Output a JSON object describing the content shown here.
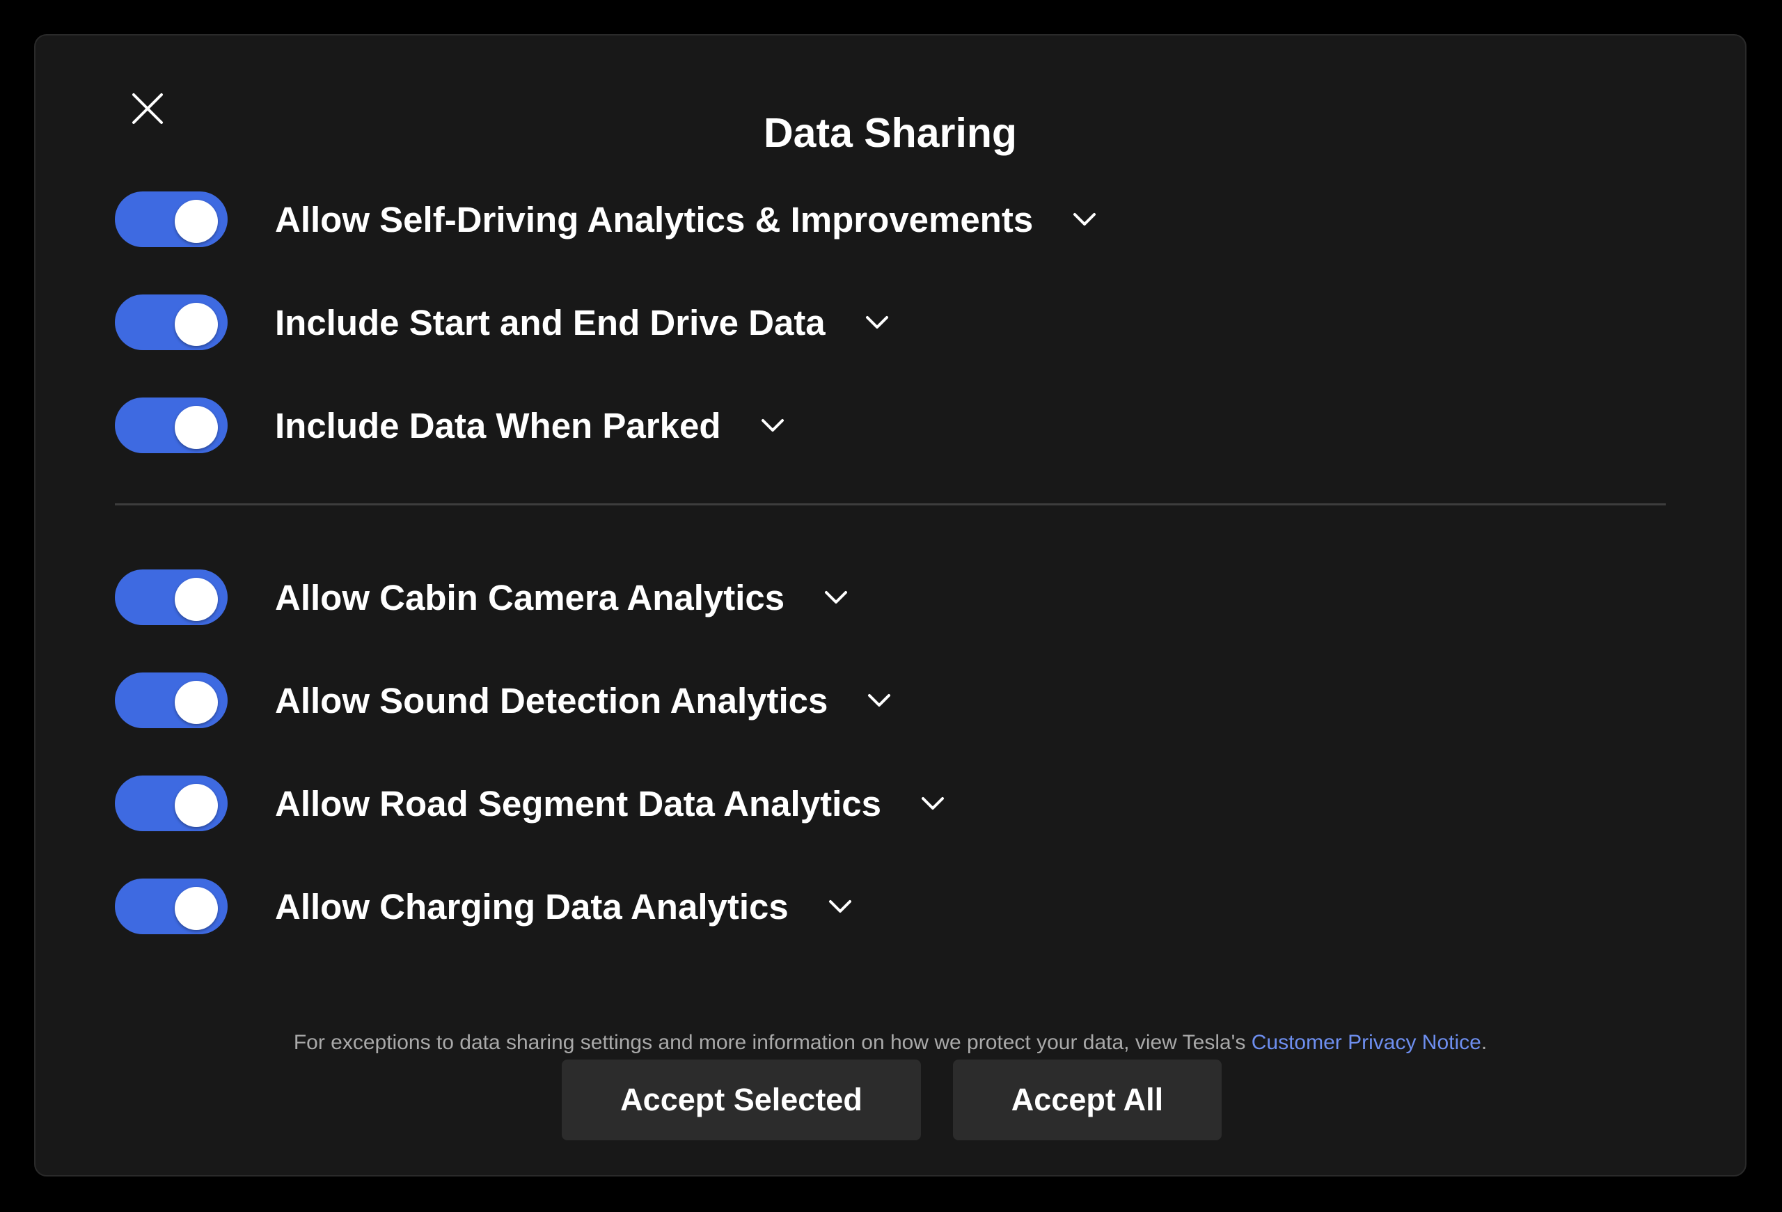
{
  "dialog": {
    "title": "Data Sharing",
    "close_icon": "close-icon"
  },
  "toggles_group1": [
    {
      "label": "Allow Self-Driving Analytics & Improvements",
      "enabled": true
    },
    {
      "label": "Include Start and End Drive Data",
      "enabled": true
    },
    {
      "label": "Include Data When Parked",
      "enabled": true
    }
  ],
  "toggles_group2": [
    {
      "label": "Allow Cabin Camera Analytics",
      "enabled": true
    },
    {
      "label": "Allow Sound Detection Analytics",
      "enabled": true
    },
    {
      "label": "Allow Road Segment Data Analytics",
      "enabled": true
    },
    {
      "label": "Allow Charging Data Analytics",
      "enabled": true
    }
  ],
  "notice": {
    "text_before": "For exceptions to data sharing settings and more information on how we protect your data, view Tesla's ",
    "link_text": "Customer Privacy Notice",
    "text_after": "."
  },
  "buttons": {
    "accept_selected": "Accept Selected",
    "accept_all": "Accept All"
  },
  "colors": {
    "toggle_on": "#3e6ae1",
    "link": "#6e8ff0",
    "background": "#181818"
  }
}
